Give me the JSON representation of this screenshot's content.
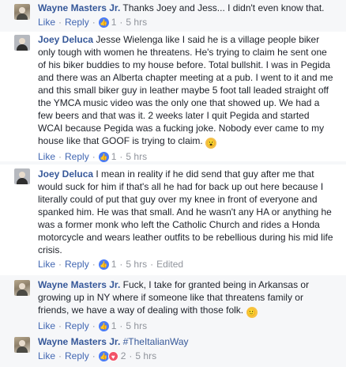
{
  "comments": [
    {
      "name": "Wayne Masters Jr.",
      "text": "Thanks Joey and Jess... I didn't even know that.",
      "like": "Like",
      "reply": "Reply",
      "reactions": "1",
      "time": "5 hrs"
    },
    {
      "name": "Joey Deluca",
      "text": "Jesse Wielenga like I said he is a village people biker only tough with women he threatens. He's trying to claim he sent one of his biker buddies to my house before. Total bullshit. I was in Pegida and there was an Alberta chapter meeting at a pub. I went to it and me and this small biker guy in leather maybe 5 foot tall leaded straight off the YMCA music video was the only one that showed up. We had a few beers and that was it. 2 weeks later I quit Pegida and started WCAI because Pegida was a fucking joke. Nobody ever came to my house like that GOOF is trying to claim.",
      "emoji": "😮",
      "like": "Like",
      "reply": "Reply",
      "reactions": "1",
      "time": "5 hrs"
    },
    {
      "name": "Joey Deluca",
      "text": "I mean in reality if he did send that guy after me that would suck for him if that's all he had for back up out here because I literally could of put that guy over my knee in front of everyone and spanked him. He was that small. And he wasn't any HA or anything he was a former monk who left the Catholic Church and rides a Honda motorcycle and wears leather outfits to be rebellious during his mid life crisis.",
      "like": "Like",
      "reply": "Reply",
      "reactions": "1",
      "time": "5 hrs",
      "edited": "Edited"
    },
    {
      "name": "Wayne Masters Jr.",
      "text": "Fuck, I take for granted being in Arkansas or growing up in NY where if someone like that threatens family or friends, we have a way of dealing with those folk.",
      "emoji": "🙂",
      "like": "Like",
      "reply": "Reply",
      "reactions": "1",
      "time": "5 hrs"
    },
    {
      "name": "Wayne Masters Jr.",
      "hashtag": "#TheItalianWay",
      "like": "Like",
      "reply": "Reply",
      "reactions": "2",
      "time": "5 hrs"
    }
  ],
  "icons": {
    "like": "thumbs-up-icon",
    "love": "heart-icon"
  },
  "colors": {
    "name": "#365899",
    "link": "#4267b2",
    "meta": "#90949c",
    "like_icon": "#4a7cf6",
    "love_icon": "#f25268"
  }
}
